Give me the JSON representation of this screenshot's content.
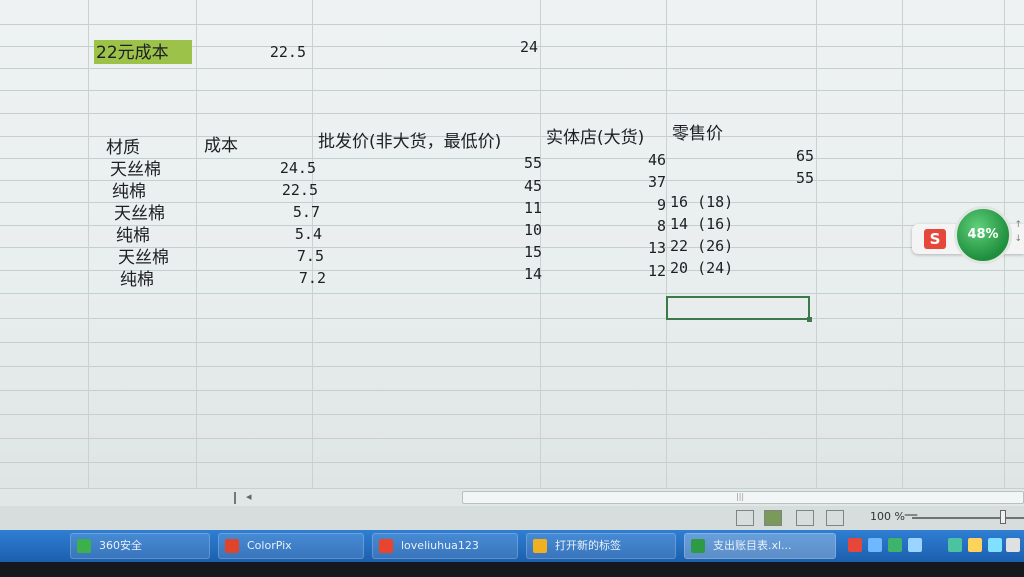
{
  "top_row": {
    "label": "22元成本",
    "v1": "22.5",
    "v2": "24"
  },
  "headers": {
    "material": "材质",
    "cost": "成本",
    "wholesale": "批发价(非大货，最低价)",
    "store": "实体店(大货)",
    "retail": "零售价"
  },
  "rows": [
    {
      "material": "天丝棉",
      "cost": "24.5",
      "wholesale": "55",
      "store": "46",
      "retail": "65"
    },
    {
      "material": "纯棉",
      "cost": "22.5",
      "wholesale": "45",
      "store": "37",
      "retail": "55"
    },
    {
      "material": "天丝棉",
      "cost": "5.7",
      "wholesale": "11",
      "store": "9",
      "retail": "16 (18)"
    },
    {
      "material": "纯棉",
      "cost": "5.4",
      "wholesale": "10",
      "store": "8",
      "retail": "14 (16)"
    },
    {
      "material": "天丝棉",
      "cost": "7.5",
      "wholesale": "15",
      "store": "13",
      "retail": "22 (26)"
    },
    {
      "material": "纯棉",
      "cost": "7.2",
      "wholesale": "14",
      "store": "12",
      "retail": "20 (24)"
    }
  ],
  "float_widget": {
    "logo": "S",
    "percent": "48%",
    "up": "↑",
    "down": "↓"
  },
  "status": {
    "zoom_label": "100 %",
    "zoom_minus": "—",
    "grip": "|||",
    "left_arrow": "◂"
  },
  "taskbar": {
    "items": [
      {
        "label": "360安全",
        "icon_color": "#3cb04a"
      },
      {
        "label": "ColorPix",
        "icon_color": "#e0452c"
      },
      {
        "label": "loveliuhua123",
        "icon_color": "#e8452c"
      },
      {
        "label": "打开新的标签",
        "icon_color": "#f0b020"
      },
      {
        "label": "支出账目表.xl...",
        "icon_color": "#2f9a44"
      }
    ]
  }
}
